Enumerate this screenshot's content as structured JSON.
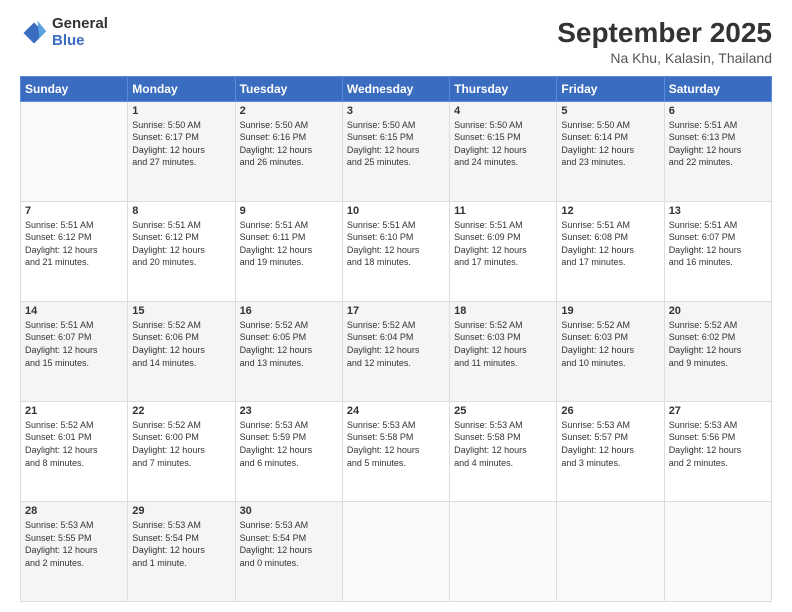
{
  "header": {
    "logo_general": "General",
    "logo_blue": "Blue",
    "main_title": "September 2025",
    "subtitle": "Na Khu, Kalasin, Thailand"
  },
  "calendar": {
    "headers": [
      "Sunday",
      "Monday",
      "Tuesday",
      "Wednesday",
      "Thursday",
      "Friday",
      "Saturday"
    ],
    "weeks": [
      [
        {
          "day": "",
          "info": ""
        },
        {
          "day": "1",
          "info": "Sunrise: 5:50 AM\nSunset: 6:17 PM\nDaylight: 12 hours\nand 27 minutes."
        },
        {
          "day": "2",
          "info": "Sunrise: 5:50 AM\nSunset: 6:16 PM\nDaylight: 12 hours\nand 26 minutes."
        },
        {
          "day": "3",
          "info": "Sunrise: 5:50 AM\nSunset: 6:15 PM\nDaylight: 12 hours\nand 25 minutes."
        },
        {
          "day": "4",
          "info": "Sunrise: 5:50 AM\nSunset: 6:15 PM\nDaylight: 12 hours\nand 24 minutes."
        },
        {
          "day": "5",
          "info": "Sunrise: 5:50 AM\nSunset: 6:14 PM\nDaylight: 12 hours\nand 23 minutes."
        },
        {
          "day": "6",
          "info": "Sunrise: 5:51 AM\nSunset: 6:13 PM\nDaylight: 12 hours\nand 22 minutes."
        }
      ],
      [
        {
          "day": "7",
          "info": "Sunrise: 5:51 AM\nSunset: 6:12 PM\nDaylight: 12 hours\nand 21 minutes."
        },
        {
          "day": "8",
          "info": "Sunrise: 5:51 AM\nSunset: 6:12 PM\nDaylight: 12 hours\nand 20 minutes."
        },
        {
          "day": "9",
          "info": "Sunrise: 5:51 AM\nSunset: 6:11 PM\nDaylight: 12 hours\nand 19 minutes."
        },
        {
          "day": "10",
          "info": "Sunrise: 5:51 AM\nSunset: 6:10 PM\nDaylight: 12 hours\nand 18 minutes."
        },
        {
          "day": "11",
          "info": "Sunrise: 5:51 AM\nSunset: 6:09 PM\nDaylight: 12 hours\nand 17 minutes."
        },
        {
          "day": "12",
          "info": "Sunrise: 5:51 AM\nSunset: 6:08 PM\nDaylight: 12 hours\nand 17 minutes."
        },
        {
          "day": "13",
          "info": "Sunrise: 5:51 AM\nSunset: 6:07 PM\nDaylight: 12 hours\nand 16 minutes."
        }
      ],
      [
        {
          "day": "14",
          "info": "Sunrise: 5:51 AM\nSunset: 6:07 PM\nDaylight: 12 hours\nand 15 minutes."
        },
        {
          "day": "15",
          "info": "Sunrise: 5:52 AM\nSunset: 6:06 PM\nDaylight: 12 hours\nand 14 minutes."
        },
        {
          "day": "16",
          "info": "Sunrise: 5:52 AM\nSunset: 6:05 PM\nDaylight: 12 hours\nand 13 minutes."
        },
        {
          "day": "17",
          "info": "Sunrise: 5:52 AM\nSunset: 6:04 PM\nDaylight: 12 hours\nand 12 minutes."
        },
        {
          "day": "18",
          "info": "Sunrise: 5:52 AM\nSunset: 6:03 PM\nDaylight: 12 hours\nand 11 minutes."
        },
        {
          "day": "19",
          "info": "Sunrise: 5:52 AM\nSunset: 6:03 PM\nDaylight: 12 hours\nand 10 minutes."
        },
        {
          "day": "20",
          "info": "Sunrise: 5:52 AM\nSunset: 6:02 PM\nDaylight: 12 hours\nand 9 minutes."
        }
      ],
      [
        {
          "day": "21",
          "info": "Sunrise: 5:52 AM\nSunset: 6:01 PM\nDaylight: 12 hours\nand 8 minutes."
        },
        {
          "day": "22",
          "info": "Sunrise: 5:52 AM\nSunset: 6:00 PM\nDaylight: 12 hours\nand 7 minutes."
        },
        {
          "day": "23",
          "info": "Sunrise: 5:53 AM\nSunset: 5:59 PM\nDaylight: 12 hours\nand 6 minutes."
        },
        {
          "day": "24",
          "info": "Sunrise: 5:53 AM\nSunset: 5:58 PM\nDaylight: 12 hours\nand 5 minutes."
        },
        {
          "day": "25",
          "info": "Sunrise: 5:53 AM\nSunset: 5:58 PM\nDaylight: 12 hours\nand 4 minutes."
        },
        {
          "day": "26",
          "info": "Sunrise: 5:53 AM\nSunset: 5:57 PM\nDaylight: 12 hours\nand 3 minutes."
        },
        {
          "day": "27",
          "info": "Sunrise: 5:53 AM\nSunset: 5:56 PM\nDaylight: 12 hours\nand 2 minutes."
        }
      ],
      [
        {
          "day": "28",
          "info": "Sunrise: 5:53 AM\nSunset: 5:55 PM\nDaylight: 12 hours\nand 2 minutes."
        },
        {
          "day": "29",
          "info": "Sunrise: 5:53 AM\nSunset: 5:54 PM\nDaylight: 12 hours\nand 1 minute."
        },
        {
          "day": "30",
          "info": "Sunrise: 5:53 AM\nSunset: 5:54 PM\nDaylight: 12 hours\nand 0 minutes."
        },
        {
          "day": "",
          "info": ""
        },
        {
          "day": "",
          "info": ""
        },
        {
          "day": "",
          "info": ""
        },
        {
          "day": "",
          "info": ""
        }
      ]
    ]
  }
}
